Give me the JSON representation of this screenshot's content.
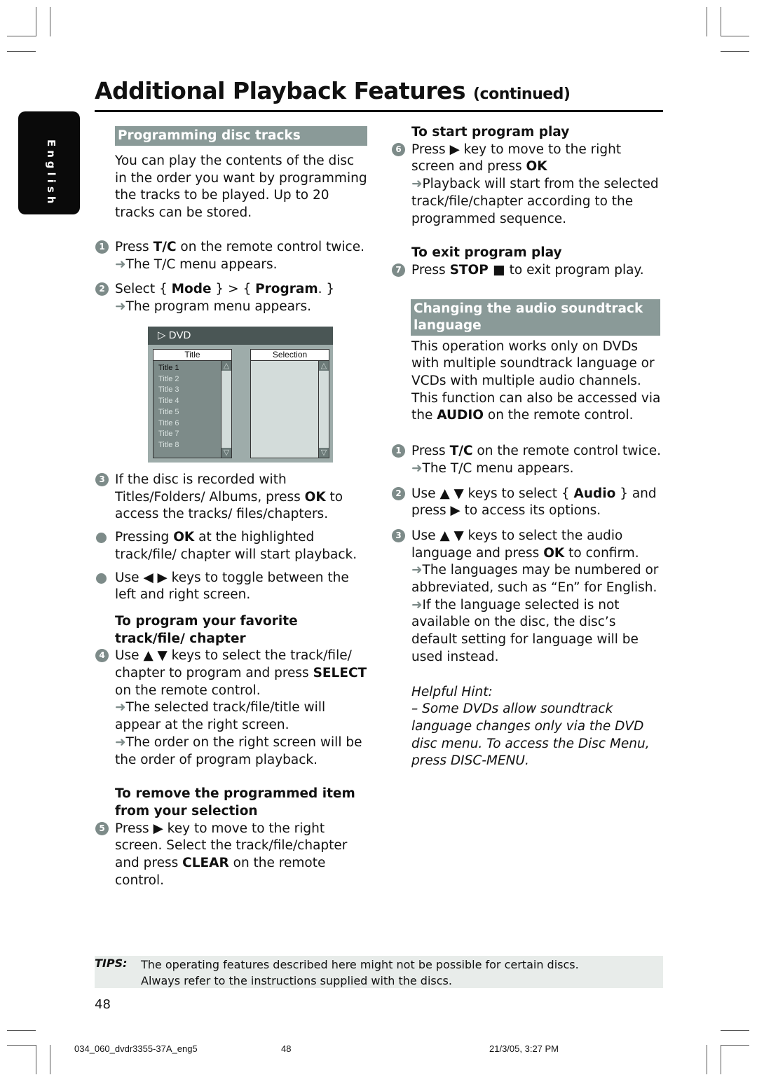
{
  "header": {
    "title": "Additional Playback Features",
    "continued": "(continued)",
    "language_tab": "English"
  },
  "left": {
    "section_title": "Programming disc tracks",
    "intro": "You can play the contents of the disc in the order you want by programming the tracks to be played. Up to 20 tracks can be stored.",
    "step1": {
      "num": "1",
      "pre": "Press ",
      "bold": "T/C",
      "post": " on the remote control twice.",
      "result": "The T/C menu appears."
    },
    "step2": {
      "num": "2",
      "pre": "Select { ",
      "bold1": "Mode",
      "mid": " } > { ",
      "bold2": "Program",
      "post": ". }",
      "result": "The program menu appears."
    },
    "dvd_menu": {
      "header": "DVD",
      "left_panel_title": "Title",
      "right_panel_title": "Selection",
      "items": [
        "Title 1",
        "Title 2",
        "Title 3",
        "Title 4",
        "Title 5",
        "Title 6",
        "Title 7",
        "Title 8"
      ],
      "selected_item": "Title 1"
    },
    "step3": {
      "num": "3",
      "pre": "If the disc is recorded with Titles/Folders/ Albums, press ",
      "bold": "OK",
      "post": " to access the tracks/ files/chapters."
    },
    "bullet1": {
      "pre": "Pressing ",
      "bold": "OK",
      "post": " at the highlighted track/file/ chapter will start playback."
    },
    "bullet2": {
      "text": "Use ◀ ▶ keys to toggle between the left and right screen."
    },
    "sub1": "To program your favorite track/file/ chapter",
    "step4": {
      "num": "4",
      "pre": "Use ▲ ▼ keys to select the track/file/ chapter to program and press ",
      "bold": "SELECT",
      "post": " on the remote control.",
      "result1": "The selected track/file/title will appear at the right screen.",
      "result2": "The order on the right screen will be the order of program playback."
    },
    "sub2": "To remove the programmed item from your selection",
    "step5": {
      "num": "5",
      "pre": "Press ▶ key to move to the right screen. Select the track/file/chapter and press ",
      "bold": "CLEAR",
      "post": " on the remote control."
    }
  },
  "right": {
    "sub3": "To start program play",
    "step6": {
      "num": "6",
      "pre": "Press ▶ key to move to the right screen and press ",
      "bold": "OK",
      "result": "Playback will start from the selected track/file/chapter according to the programmed sequence."
    },
    "sub4": "To exit program play",
    "step7": {
      "num": "7",
      "pre": "Press ",
      "bold": "STOP ■",
      "post": " to exit program play."
    },
    "section_title": "Changing the audio soundtrack language",
    "intro1": "This operation works only on DVDs with multiple soundtrack language or VCDs with multiple audio channels.",
    "intro2_pre": "This function can also be accessed via the ",
    "intro2_bold": "AUDIO",
    "intro2_post": " on the remote control.",
    "a1": {
      "num": "1",
      "pre": "Press ",
      "bold": "T/C",
      "post": " on the remote control twice.",
      "result": "The T/C menu appears."
    },
    "a2": {
      "num": "2",
      "pre": "Use ▲ ▼ keys to select { ",
      "bold": "Audio",
      "post": " } and press ▶ to access its options."
    },
    "a3": {
      "num": "3",
      "pre": "Use ▲ ▼ keys to select the audio language and press ",
      "bold": "OK",
      "post": " to confirm.",
      "result1": "The languages may be numbered or abbreviated, such as “En” for English.",
      "result2": "If the language selected is not available on the disc, the disc’s default setting for language will be used instead."
    },
    "hint_title": "Helpful Hint:",
    "hint_text": "–  Some DVDs allow soundtrack language changes only via the DVD disc menu. To access the Disc Menu, press DISC-MENU."
  },
  "tips": {
    "label": "TIPS:",
    "line1": "The operating features described here might not be possible for certain discs.",
    "line2": "Always refer to the instructions supplied with the discs."
  },
  "page_number": "48",
  "footer": {
    "file": "034_060_dvdr3355-37A_eng5",
    "page": "48",
    "timestamp": "21/3/05, 3:27 PM"
  },
  "colors": {
    "section_header_bg": "#8a9a98",
    "step_badge": "#7d8b89",
    "dvd_bar": "#4a5655",
    "tips_bg": "#e8ecea"
  }
}
